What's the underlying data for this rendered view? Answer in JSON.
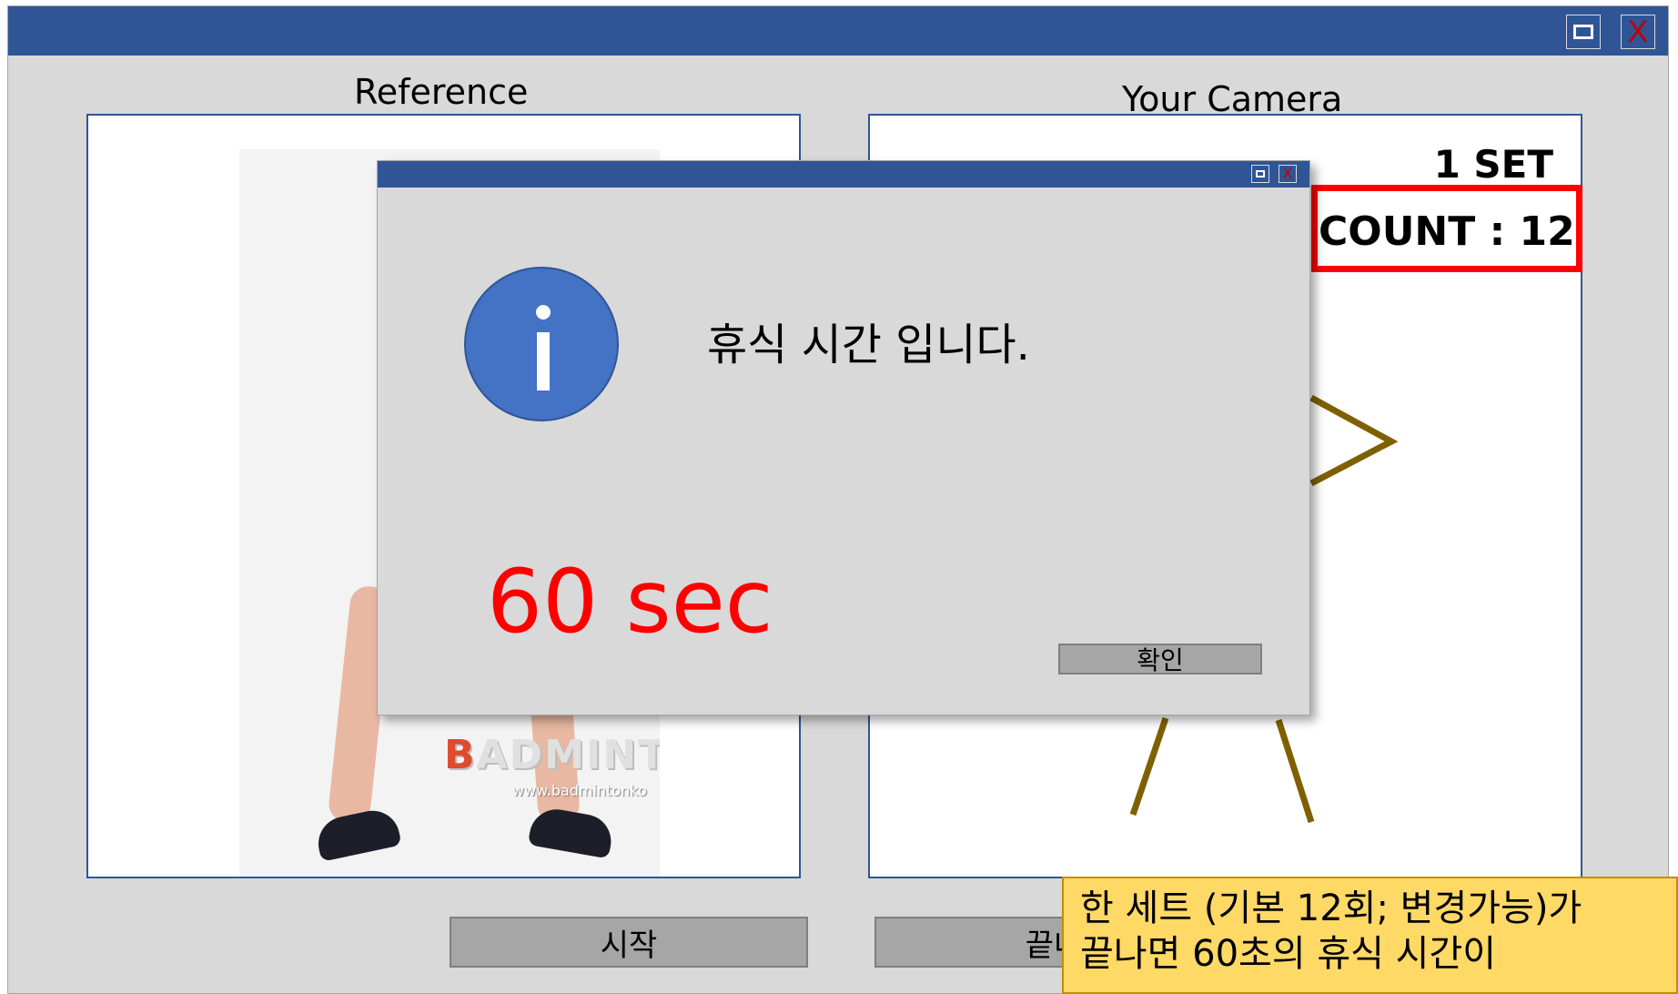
{
  "window": {
    "maximize_icon": "maximize-icon",
    "close_label": "X"
  },
  "panels": {
    "reference_label": "Reference",
    "camera_label": "Your Camera"
  },
  "reference_photo": {
    "logo_first": "B",
    "logo_rest": "ADMINT",
    "url": "www.badmintonko"
  },
  "camera": {
    "set_text": "1 SET",
    "count_text": "COUNT : 12"
  },
  "buttons": {
    "start": "시작",
    "end": "끝내"
  },
  "note": {
    "text": "한 세트 (기본 12회; 변경가능)가\n끝나면 60초의 휴식 시간이"
  },
  "dialog": {
    "message": "휴식 시간 입니다.",
    "timer": "60 sec",
    "ok_label": "확인",
    "close_label": "X",
    "icon": "info-icon"
  },
  "colors": {
    "titlebar": "#2f5597",
    "background": "#d9d9d9",
    "accent_red": "#ff0000",
    "note_bg": "#ffd966",
    "info_blue": "#4472c4",
    "skeleton": "#7f6000"
  }
}
